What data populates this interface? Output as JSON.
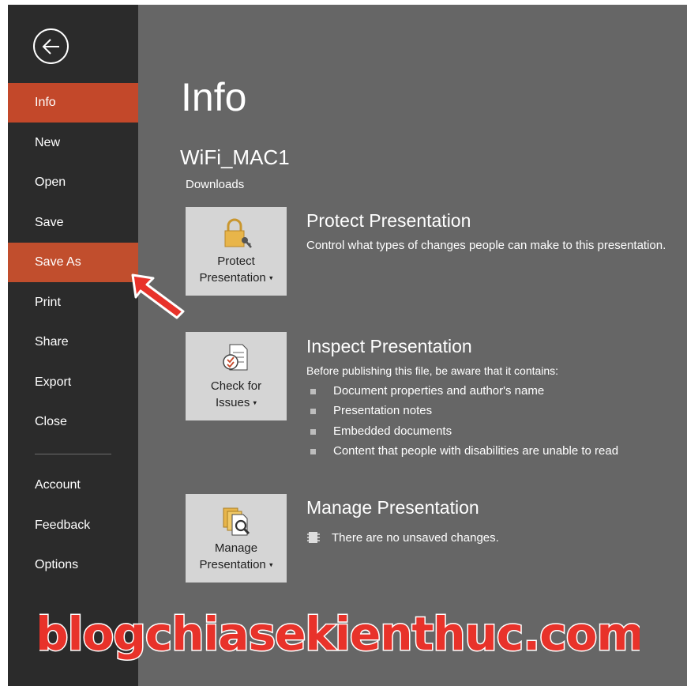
{
  "sidebar": {
    "items": [
      {
        "label": "Info"
      },
      {
        "label": "New"
      },
      {
        "label": "Open"
      },
      {
        "label": "Save"
      },
      {
        "label": "Save As"
      },
      {
        "label": "Print"
      },
      {
        "label": "Share"
      },
      {
        "label": "Export"
      },
      {
        "label": "Close"
      },
      {
        "label": "Account"
      },
      {
        "label": "Feedback"
      },
      {
        "label": "Options"
      }
    ]
  },
  "main": {
    "title": "Info",
    "file_name": "WiFi_MAC1",
    "file_location": "Downloads",
    "protect": {
      "tile_line1": "Protect",
      "tile_line2": "Presentation",
      "title": "Protect Presentation",
      "description": "Control what types of changes people can make to this presentation."
    },
    "inspect": {
      "tile_line1": "Check for",
      "tile_line2": "Issues",
      "title": "Inspect Presentation",
      "description": "Before publishing this file, be aware that it contains:",
      "bullets": [
        "Document properties and author's name",
        "Presentation notes",
        "Embedded documents",
        "Content that people with disabilities are unable to read"
      ]
    },
    "manage": {
      "tile_line1": "Manage",
      "tile_line2": "Presentation",
      "title": "Manage Presentation",
      "status": "There are no unsaved changes."
    }
  },
  "watermark": {
    "text": "blogchiasekienthuc.com"
  },
  "colors": {
    "accent": "#c3482a",
    "sidebar": "#2b2b2b",
    "content": "#666666",
    "tile": "#d5d5d5",
    "watermark": "#e8322a"
  }
}
